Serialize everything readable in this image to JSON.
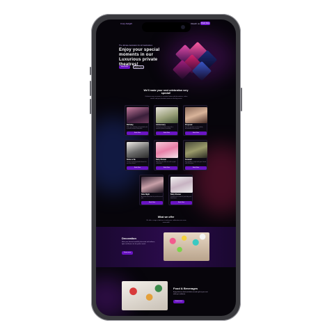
{
  "nav": {
    "logo": "Cozy Delight",
    "link": "Reach us",
    "cta": "Book Now"
  },
  "hero": {
    "small": "The ultimate destination for all Celebrations",
    "title": "Enjoy your special moments in our Luxurious private theatres!",
    "btn_primary": "Book Now",
    "btn_secondary": "Explore More"
  },
  "occasions": {
    "title": "We'll make your next celebration very special!",
    "subtitle": "Celebrate every occasion in a private theatre with decorations, cakes, snacks and your favourite movies on the big screen.",
    "cards": [
      {
        "title": "Birthday",
        "text": "Make your birthday unforgettable with a private theatre celebration.",
        "btn": "Book Now"
      },
      {
        "title": "Anniversary",
        "text": "Celebrate your love story with a romantic private screening.",
        "btn": "Book Now"
      },
      {
        "title": "Proposal",
        "text": "Pop the question in a beautifully decorated private theatre.",
        "btn": "Book Now"
      },
      {
        "title": "Bride to Be",
        "text": "Throw an amazing bridal shower for your best friend.",
        "btn": "Book Now"
      },
      {
        "title": "Baby Shower",
        "text": "Welcome your little one with a joyful celebration.",
        "btn": "Book Now"
      },
      {
        "title": "Farewell",
        "text": "Say goodbye in style with your friends and colleagues.",
        "btn": "Book Now"
      },
      {
        "title": "Date Night",
        "text": "A private movie date for just the two of you.",
        "btn": "Book Now"
      },
      {
        "title": "Baby Shower",
        "text": "Celebrate the arrival of your baby with loved ones.",
        "btn": "Book Now"
      }
    ]
  },
  "offer": {
    "title": "What we offer",
    "subtitle": "We offer a range of add-ons to make your celebration even more memorable."
  },
  "decoration": {
    "title": "Decoration",
    "text": "Make your theatre beautifully decorated with balloons, lights and flowers for the perfect mood.",
    "btn": "Know more"
  },
  "food": {
    "title": "Food & Beverages",
    "text": "Enjoy delicious food and drinks served right at your seat while you celebrate.",
    "btn": "Know more"
  }
}
